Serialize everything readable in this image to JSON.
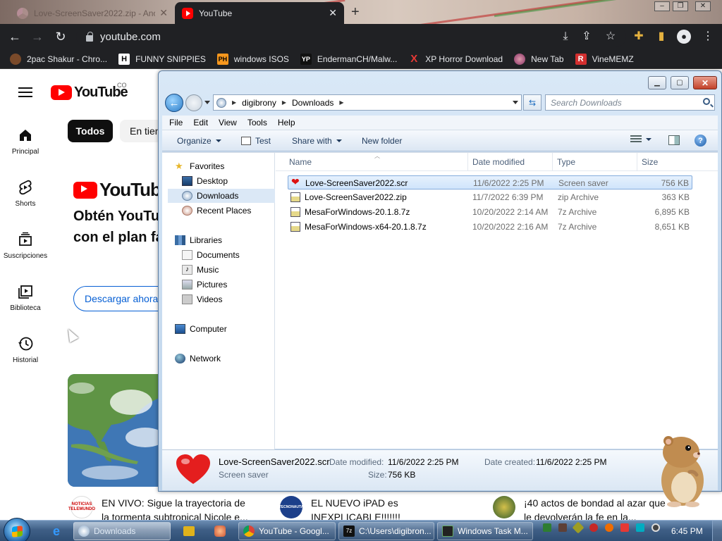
{
  "chrome": {
    "tabs": [
      {
        "label": "Love-ScreenSaver2022.zip - Ano"
      },
      {
        "label": "YouTube"
      }
    ],
    "url": "youtube.com",
    "bookmarks": [
      {
        "label": "2pac Shakur - Chro...",
        "icon": "2pac-icon"
      },
      {
        "label": "FUNNY SNIPPIES",
        "icon": "H"
      },
      {
        "label": "windows ISOS",
        "icon": "PH"
      },
      {
        "label": "EndermanCH/Malw...",
        "icon": "YP"
      },
      {
        "label": "XP Horror Download",
        "icon": "X"
      },
      {
        "label": "New Tab",
        "icon": "globe-icon"
      },
      {
        "label": "VineMEMZ",
        "icon": "R"
      }
    ]
  },
  "youtube": {
    "logo_text": "YouTube",
    "country": "CO",
    "sidebar": [
      {
        "label": "Principal",
        "icon": "home-icon"
      },
      {
        "label": "Shorts",
        "icon": "shorts-icon"
      },
      {
        "label": "Suscripciones",
        "icon": "subscriptions-icon"
      },
      {
        "label": "Biblioteca",
        "icon": "library-icon"
      },
      {
        "label": "Historial",
        "icon": "history-icon"
      }
    ],
    "chips": {
      "active": "Todos",
      "next": "En tien"
    },
    "premium": {
      "logo_text": "YouTube P",
      "promo_line1": "Obtén YouTu",
      "promo_line2": "con el plan fa",
      "button": "Descargar ahora"
    },
    "videos": [
      {
        "title_line1": "EN VIVO: Sigue la trayectoria de",
        "title_line2": "la tormenta subtropical Nicole e...",
        "channel_badge": "NOTICIAS TELEMUNDO"
      },
      {
        "title_line1": "EL NUEVO iPAD es",
        "title_line2": "INEXPLICABLE!!!!!!!",
        "channel_badge": "TECNONAUTA"
      },
      {
        "title_line1": "¡40 actos de bondad al azar que",
        "title_line2": "le devolverán la fe en la...",
        "channel_badge": ""
      }
    ]
  },
  "explorer": {
    "breadcrumb": [
      "digibrony",
      "Downloads"
    ],
    "search_placeholder": "Search Downloads",
    "menu": [
      "File",
      "Edit",
      "View",
      "Tools",
      "Help"
    ],
    "commands": {
      "organize": "Organize",
      "test": "Test",
      "share": "Share with",
      "new_folder": "New folder"
    },
    "nav": {
      "favorites": "Favorites",
      "desktop": "Desktop",
      "downloads": "Downloads",
      "recent": "Recent Places",
      "libraries": "Libraries",
      "documents": "Documents",
      "music": "Music",
      "pictures": "Pictures",
      "videos": "Videos",
      "computer": "Computer",
      "network": "Network"
    },
    "columns": {
      "name": "Name",
      "date": "Date modified",
      "type": "Type",
      "size": "Size"
    },
    "files": [
      {
        "name": "Love-ScreenSaver2022.scr",
        "date": "11/6/2022 2:25 PM",
        "type": "Screen saver",
        "size": "756 KB",
        "selected": true
      },
      {
        "name": "Love-ScreenSaver2022.zip",
        "date": "11/7/2022 6:39 PM",
        "type": "zip Archive",
        "size": "363 KB",
        "selected": false
      },
      {
        "name": "MesaForWindows-20.1.8.7z",
        "date": "10/20/2022 2:14 AM",
        "type": "7z Archive",
        "size": "6,895 KB",
        "selected": false
      },
      {
        "name": "MesaForWindows-x64-20.1.8.7z",
        "date": "10/20/2022 2:16 AM",
        "type": "7z Archive",
        "size": "8,651 KB",
        "selected": false
      }
    ],
    "details": {
      "filename": "Love-ScreenSaver2022.scr",
      "filetype": "Screen saver",
      "modified_label": "Date modified:",
      "modified_value": "11/6/2022 2:25 PM",
      "created_label": "Date created:",
      "created_value": "11/6/2022 2:25 PM",
      "size_label": "Size:",
      "size_value": "756 KB"
    }
  },
  "taskbar": {
    "buttons": [
      {
        "label": "Downloads",
        "active": true
      },
      {
        "label": "YouTube - Googl...",
        "active": false
      },
      {
        "label": "C:\\Users\\digibron...",
        "active": false
      },
      {
        "label": "Windows Task M...",
        "active": false
      }
    ],
    "clock": "6:45 PM"
  },
  "colors": {
    "youtube_red": "#ff0000",
    "chrome_dark": "#202124",
    "selection_blue": "#cfe4fb",
    "link_blue": "#065fd4"
  }
}
